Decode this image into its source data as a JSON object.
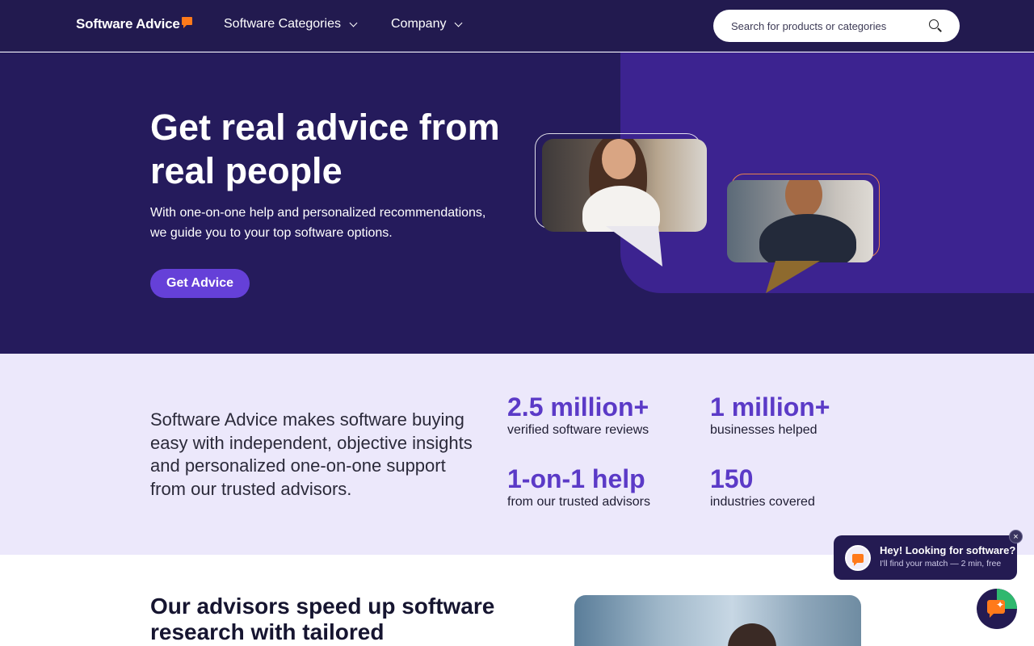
{
  "nav": {
    "logo_text": "Software Advice",
    "items": [
      {
        "label": "Software Categories"
      },
      {
        "label": "Company"
      }
    ],
    "search_placeholder": "Search for products or categories"
  },
  "hero": {
    "title": "Get real advice from real people",
    "subtitle": "With one-on-one help and personalized recommendations, we guide you to your top software options.",
    "cta_label": "Get Advice"
  },
  "stats": {
    "description": "Software Advice makes software buying easy with independent, objective insights and personalized one-on-one support from our trusted advisors.",
    "items": [
      {
        "value": "2.5 million+",
        "label": "verified software reviews"
      },
      {
        "value": "1 million+",
        "label": "businesses helped"
      },
      {
        "value": "1-on-1 help",
        "label": "from our trusted advisors"
      },
      {
        "value": "150",
        "label": "industries covered"
      }
    ]
  },
  "lower": {
    "title": "Our advisors speed up software research with tailored"
  },
  "chat": {
    "title": "Hey! Looking for software?",
    "subtitle": "I'll find your match — 2 min, free",
    "close_symbol": "×"
  },
  "colors": {
    "nav_bg": "#221a4f",
    "hero_bg": "#251b5c",
    "hero_panel": "#3c2390",
    "accent_button": "#6540d8",
    "stat_value": "#5b3ac7",
    "stats_bg": "#ece8fb",
    "brand_orange": "#ff7a1a"
  }
}
